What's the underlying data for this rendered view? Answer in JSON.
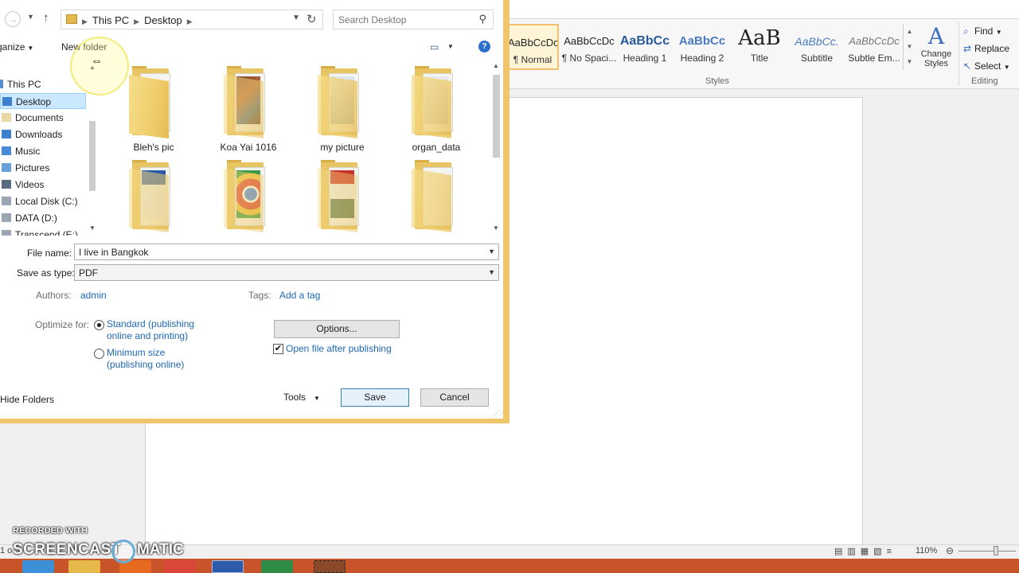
{
  "ribbon": {
    "styles": [
      {
        "sample": "AaBbCcDc",
        "name": "¶ Normal"
      },
      {
        "sample": "AaBbCcDc",
        "name": "¶ No Spaci..."
      },
      {
        "sample": "AaBbCc",
        "name": "Heading 1"
      },
      {
        "sample": "AaBbCc",
        "name": "Heading 2"
      },
      {
        "sample": "AaB",
        "name": "Title"
      },
      {
        "sample": "AaBbCc.",
        "name": "Subtitle"
      },
      {
        "sample": "AaBbCcDc",
        "name": "Subtle Em..."
      }
    ],
    "change_styles": "Change Styles",
    "styles_group": "Styles",
    "editing_group": "Editing",
    "find": "Find",
    "replace": "Replace",
    "select": "Select"
  },
  "statusbar": {
    "page": "1 o",
    "zoom": "110%"
  },
  "watermark": {
    "recorded": "RECORDED WITH",
    "screencast": "SCREENCAST",
    "matic": "MATIC"
  },
  "dialog": {
    "breadcrumb": [
      "This PC",
      "Desktop"
    ],
    "search_placeholder": "Search Desktop",
    "organize": "ganize",
    "new_folder": "New folder",
    "nav_items": [
      {
        "label": "This PC",
        "icon": "computer-icon"
      },
      {
        "label": "Desktop",
        "icon": "desktop-icon",
        "selected": true
      },
      {
        "label": "Documents",
        "icon": "documents-icon"
      },
      {
        "label": "Downloads",
        "icon": "downloads-icon"
      },
      {
        "label": "Music",
        "icon": "music-icon"
      },
      {
        "label": "Pictures",
        "icon": "pictures-icon"
      },
      {
        "label": "Videos",
        "icon": "videos-icon"
      },
      {
        "label": "Local Disk (C:)",
        "icon": "drive-icon"
      },
      {
        "label": "DATA (D:)",
        "icon": "drive-icon"
      },
      {
        "label": "Transcend (E:)",
        "icon": "drive-icon"
      }
    ],
    "files": [
      {
        "name": "Bleh's pic",
        "icon": "folder-icon"
      },
      {
        "name": "Koa Yai 1016",
        "icon": "folder-icon"
      },
      {
        "name": "my picture",
        "icon": "folder-icon"
      },
      {
        "name": "organ_data",
        "icon": "folder-icon"
      },
      {
        "name": "",
        "icon": "folder-word-icon"
      },
      {
        "name": "",
        "icon": "folder-chrome-icon"
      },
      {
        "name": "",
        "icon": "folder-pdf-icon"
      },
      {
        "name": "",
        "icon": "folder-icon"
      }
    ],
    "file_name_label": "File name:",
    "file_name_value": "I live in Bangkok",
    "save_type_label": "Save as type:",
    "save_type_value": "PDF",
    "authors_label": "Authors:",
    "authors_value": "admin",
    "tags_label": "Tags:",
    "tags_value": "Add a tag",
    "optimize_label": "Optimize for:",
    "optimize_standard": "Standard (publishing online and printing)",
    "optimize_minimum": "Minimum size (publishing online)",
    "options_button": "Options...",
    "open_after_label": "Open file after publishing",
    "open_after_checked": true,
    "hide_folders": "Hide Folders",
    "tools": "Tools",
    "save": "Save",
    "cancel": "Cancel"
  },
  "colors": {
    "dialog_border": "#f0c66b",
    "link": "#1f68b5",
    "selection": "#cce8ff",
    "taskbar": "#c8552a"
  }
}
